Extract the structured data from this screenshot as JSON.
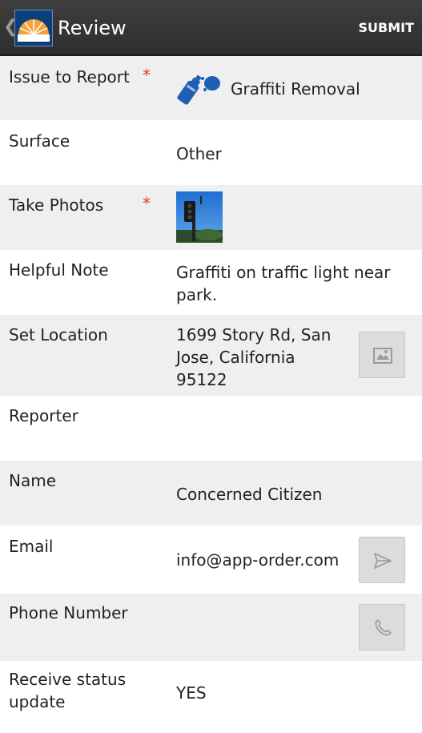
{
  "header": {
    "title": "Review",
    "submit_label": "SUBMIT"
  },
  "rows": {
    "issue": {
      "label": "Issue to Report",
      "required": "*",
      "value": "Graffiti Removal",
      "icon": "spray-paint-icon"
    },
    "surface": {
      "label": "Surface",
      "value": "Other"
    },
    "photos": {
      "label": "Take Photos",
      "required": "*"
    },
    "note": {
      "label": "Helpful Note",
      "value": "Graffiti on traffic light near park."
    },
    "location": {
      "label": "Set Location",
      "value": "1699 Story Rd, San Jose, California 95122"
    },
    "reporter": {
      "label": "Reporter"
    },
    "name": {
      "label": "Name",
      "value": "Concerned Citizen"
    },
    "email": {
      "label": "Email",
      "value": "info@app-order.com"
    },
    "phone": {
      "label": "Phone Number",
      "value": ""
    },
    "status": {
      "label": "Receive status update",
      "value": "YES"
    }
  },
  "colors": {
    "actionbar": "#333333",
    "required": "#e53935",
    "row_alt": "#efefef",
    "icon_blue": "#1e5fb3"
  }
}
